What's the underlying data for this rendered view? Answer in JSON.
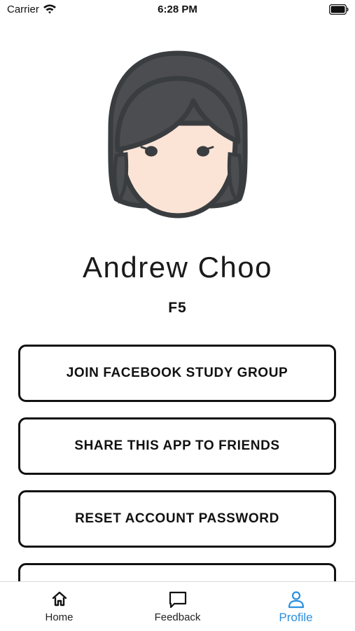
{
  "status_bar": {
    "carrier": "Carrier",
    "time": "6:28 PM",
    "wifi_icon": "wifi-icon",
    "battery_icon": "battery-icon"
  },
  "profile": {
    "avatar_icon": "female-avatar-icon",
    "name": "Andrew Choo",
    "subtitle": "F5"
  },
  "actions": {
    "join_group": "JOIN FACEBOOK STUDY GROUP",
    "share_app": "SHARE THIS APP TO FRIENDS",
    "reset_password": "RESET ACCOUNT PASSWORD"
  },
  "tab_bar": {
    "home_label": "Home",
    "feedback_label": "Feedback",
    "profile_label": "Profile",
    "active_tab": "Profile",
    "active_color": "#2a90df"
  }
}
